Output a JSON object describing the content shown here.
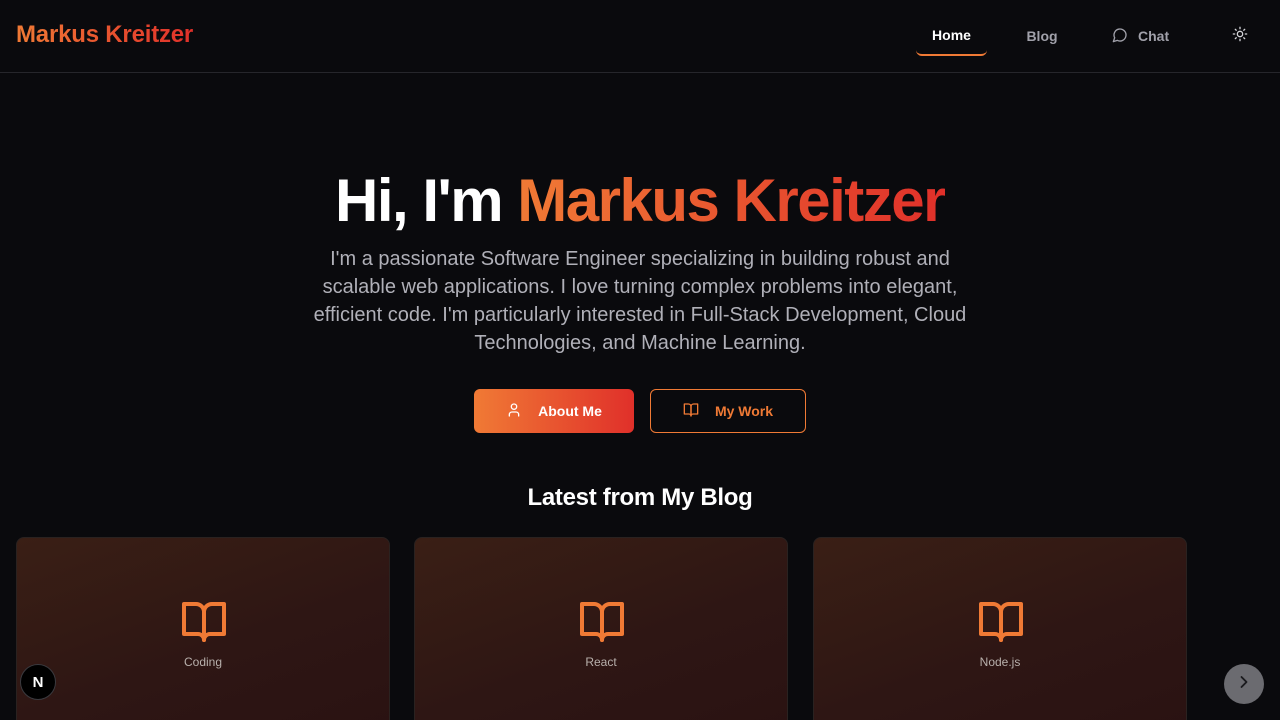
{
  "header": {
    "brand": "Markus Kreitzer",
    "nav": {
      "home": "Home",
      "blog": "Blog",
      "chat": "Chat"
    },
    "icons": {
      "chat": "message-circle-icon",
      "theme": "sun-icon"
    }
  },
  "hero": {
    "greeting": "Hi, I'm ",
    "name": "Markus Kreitzer",
    "description": "I'm a passionate Software Engineer specializing in building robust and scalable web applications. I love turning complex problems into elegant, efficient code. I'm particularly interested in Full-Stack Development, Cloud Technologies, and Machine Learning.",
    "buttons": {
      "about": "About Me",
      "work": "My Work"
    }
  },
  "blog": {
    "heading": "Latest from My Blog",
    "cards": [
      {
        "tag": "Coding",
        "icon": "book-open-icon"
      },
      {
        "tag": "React",
        "icon": "book-open-icon"
      },
      {
        "tag": "Node.js",
        "icon": "book-open-icon"
      }
    ]
  },
  "misc": {
    "badge": "N",
    "colors": {
      "accent_start": "#f07a35",
      "accent_end": "#e0302a",
      "background": "#0a0a0d"
    }
  }
}
